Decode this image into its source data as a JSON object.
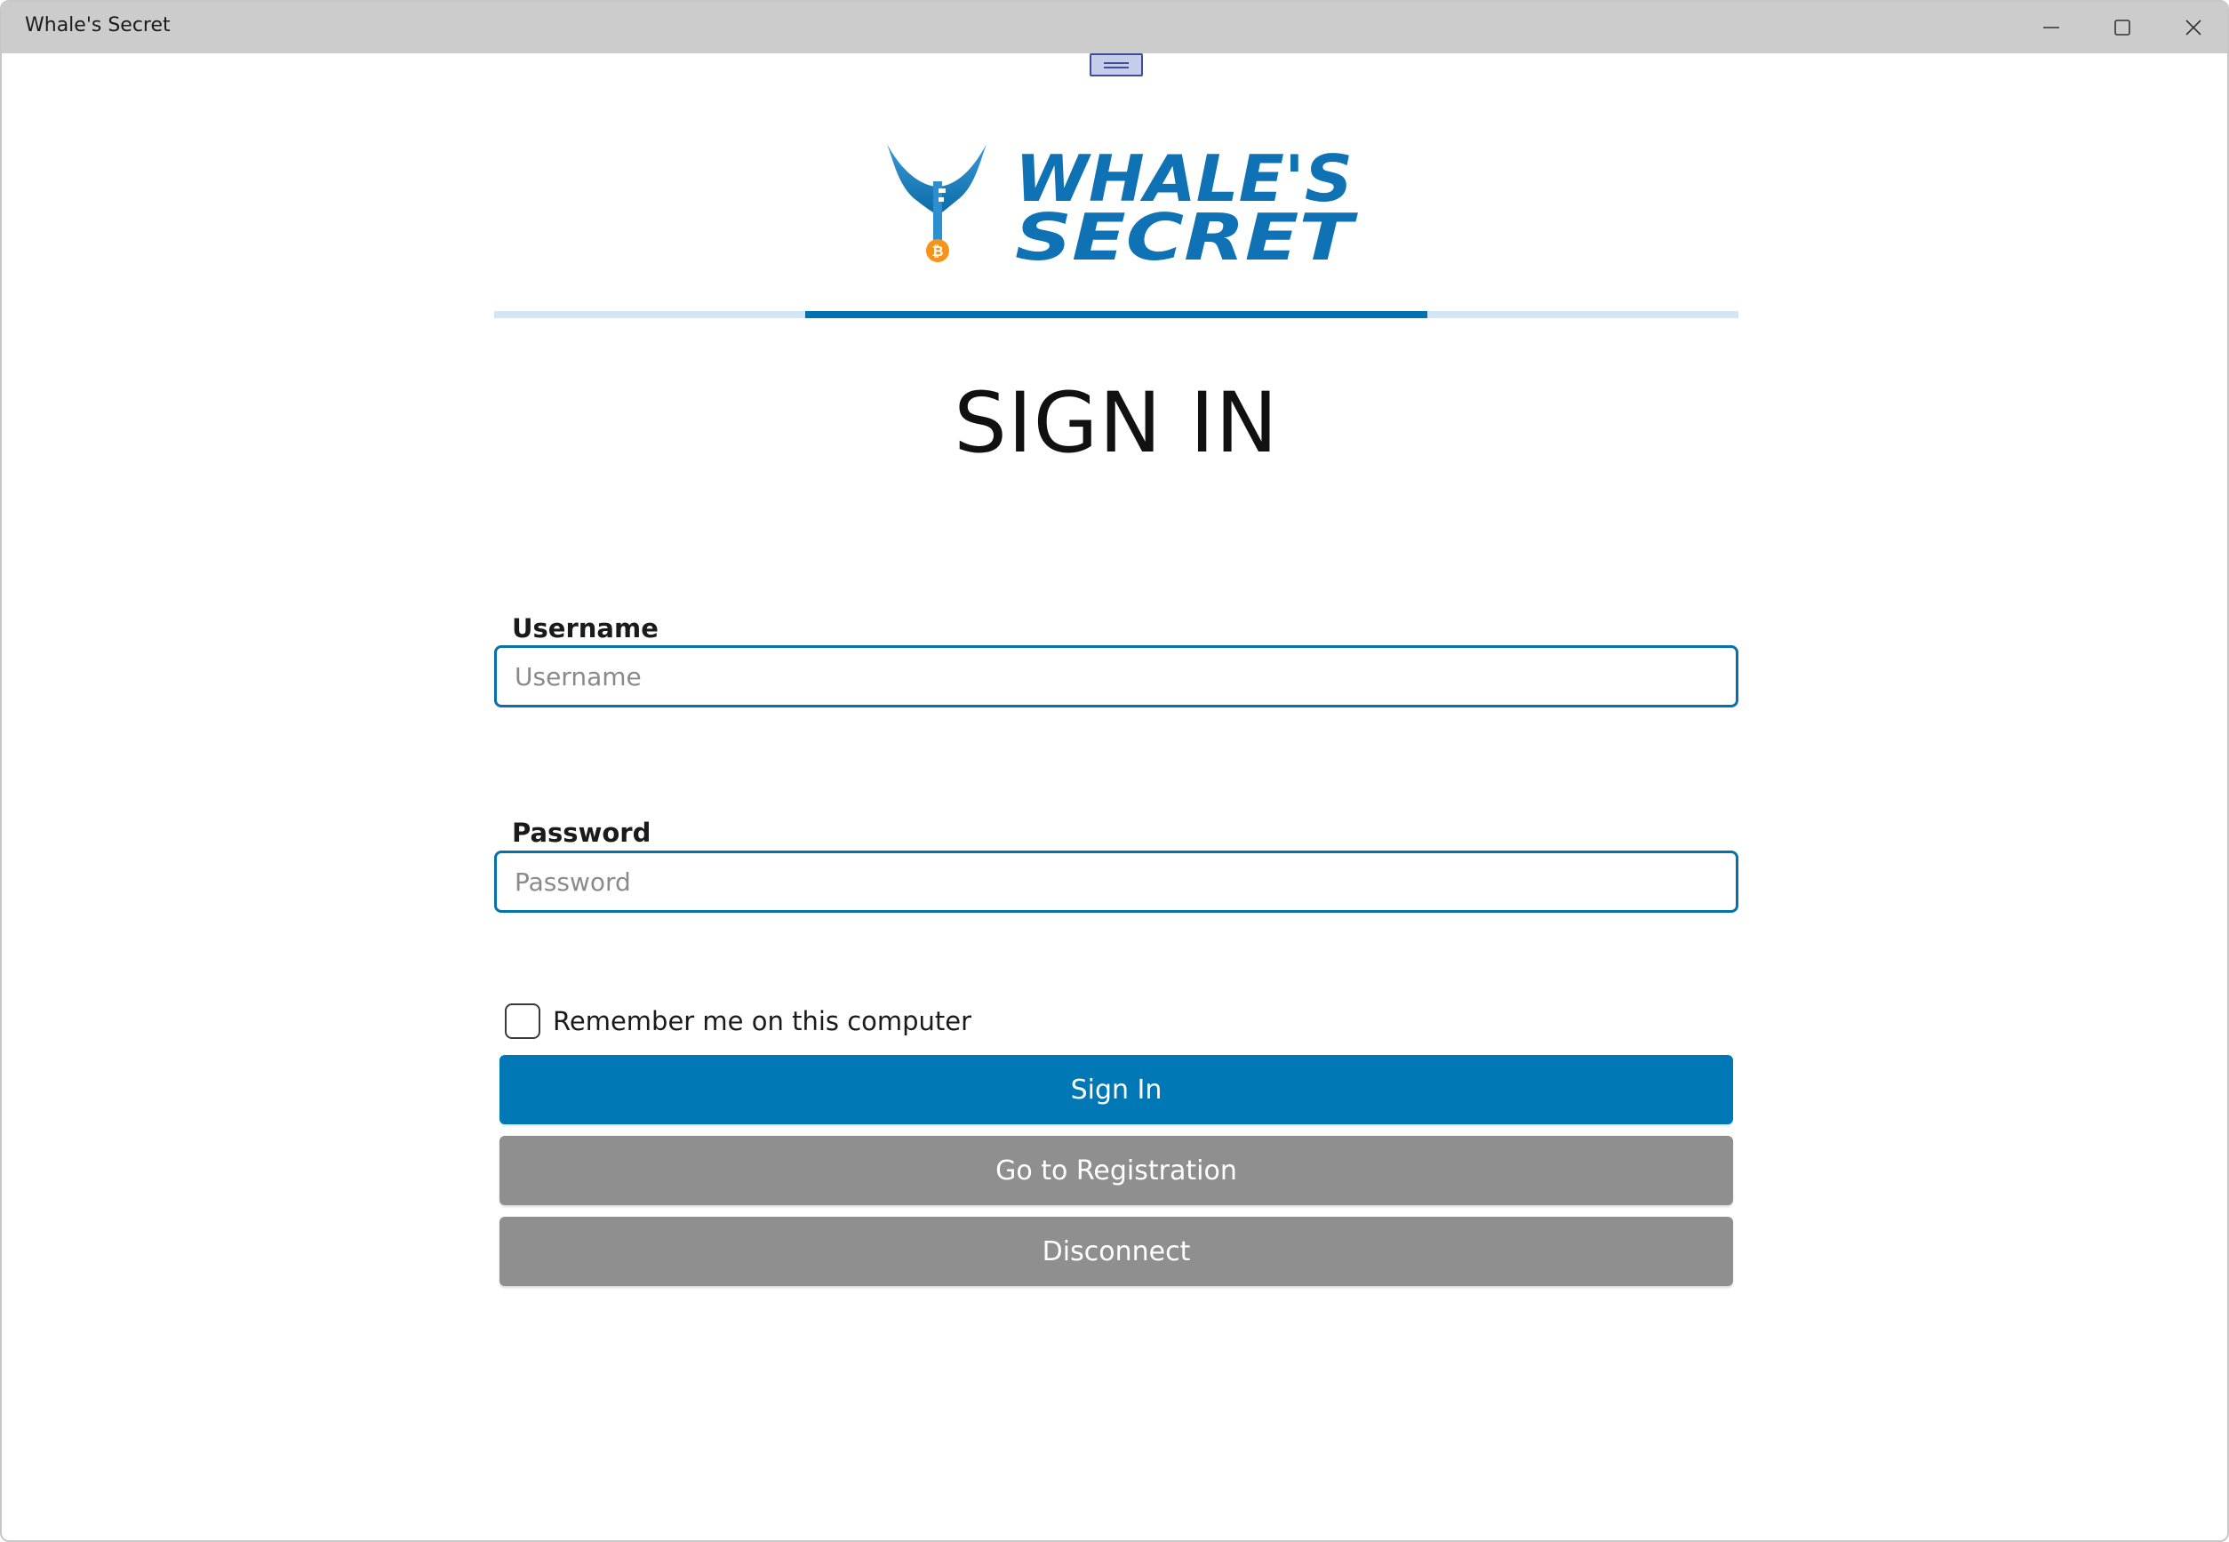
{
  "window": {
    "title": "Whale's Secret"
  },
  "colors": {
    "accent": "#0078b6",
    "secondary_button": "#8f8f8f",
    "progress_track": "#d2e6f5",
    "progress_fill": "#0072b1",
    "input_border": "#0872a8"
  },
  "titlebar_icons": [
    "minimize-icon",
    "maximize-icon",
    "close-icon"
  ],
  "logo": {
    "text_line1": "WHALE'S",
    "text_line2": "SECRET",
    "icon": "whale-tail-key-bitcoin-logo"
  },
  "progress": {
    "segment_start_fraction": 0.25,
    "segment_end_fraction": 0.75
  },
  "heading": "SIGN IN",
  "form": {
    "username": {
      "label": "Username",
      "placeholder": "Username",
      "value": ""
    },
    "password": {
      "label": "Password",
      "placeholder": "Password",
      "value": ""
    },
    "remember": {
      "label": "Remember me on this computer",
      "checked": false
    }
  },
  "buttons": {
    "sign_in": "Sign In",
    "registration": "Go to Registration",
    "disconnect": "Disconnect"
  }
}
